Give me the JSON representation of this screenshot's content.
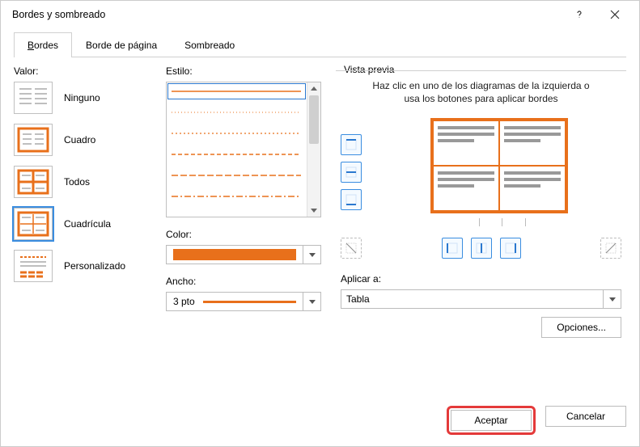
{
  "window": {
    "title": "Bordes y sombreado"
  },
  "tabs": {
    "borders": "Bordes",
    "page_border": "Borde de página",
    "shading": "Sombreado"
  },
  "valor": {
    "label": "Valor:",
    "items": [
      {
        "label": "Ninguno"
      },
      {
        "label": "Cuadro"
      },
      {
        "label": "Todos"
      },
      {
        "label": "Cuadrícula"
      },
      {
        "label": "Personalizado"
      }
    ]
  },
  "style": {
    "label": "Estilo:"
  },
  "color": {
    "label": "Color:",
    "value": "#e8701b"
  },
  "width": {
    "label": "Ancho:",
    "value": "3 pto"
  },
  "preview": {
    "legend": "Vista previa",
    "help": "Haz clic en uno de los diagramas de la izquierda o usa los botones para aplicar bordes"
  },
  "apply": {
    "label": "Aplicar a:",
    "value": "Tabla"
  },
  "buttons": {
    "options": "Opciones...",
    "ok": "Aceptar",
    "cancel": "Cancelar"
  }
}
